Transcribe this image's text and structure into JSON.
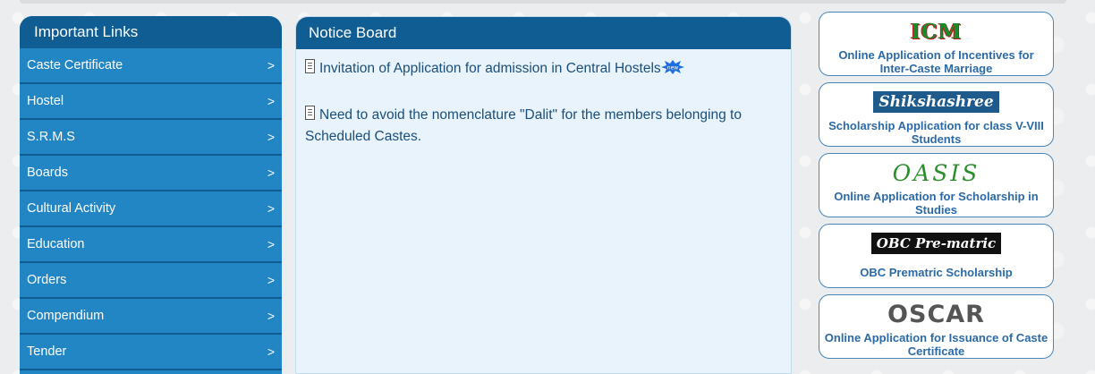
{
  "important_links": {
    "title": "Important Links",
    "items": [
      {
        "label": "Caste Certificate",
        "arrow": ">"
      },
      {
        "label": "Hostel",
        "arrow": ">"
      },
      {
        "label": "S.R.M.S",
        "arrow": ">"
      },
      {
        "label": "Boards",
        "arrow": ">"
      },
      {
        "label": "Cultural Activity",
        "arrow": ">"
      },
      {
        "label": "Education",
        "arrow": ">"
      },
      {
        "label": "Orders",
        "arrow": ">"
      },
      {
        "label": "Compendium",
        "arrow": ">"
      },
      {
        "label": "Tender",
        "arrow": ">"
      }
    ]
  },
  "notice_board": {
    "title": "Notice Board",
    "items": [
      {
        "text": "Invitation of Application for admission in Central Hostels",
        "icon": "document-icon",
        "badge": "new-badge-icon"
      },
      {
        "text": "Need to avoid the nomenclature \"Dalit\" for the members belonging to Scheduled Castes.",
        "icon": "document-icon"
      }
    ]
  },
  "cards": [
    {
      "logo": "ICM",
      "text": "Online Application of Incentives for Inter-Caste Marriage"
    },
    {
      "logo": "Shikshashree",
      "text": "Scholarship Application for class V-VIII Students"
    },
    {
      "logo": "OASIS",
      "text": "Online Application for Scholarship in Studies"
    },
    {
      "logo": "OBC Pre-matric",
      "text": "OBC Prematric Scholarship"
    },
    {
      "logo": "OSCAR",
      "text": "Online Application for Issuance of Caste Certificate"
    }
  ],
  "colors": {
    "header_dark_blue": "#0f5d93",
    "link_blue": "#2285c4",
    "notice_bg": "#e8f3fb",
    "card_text": "#2b6aa6"
  }
}
